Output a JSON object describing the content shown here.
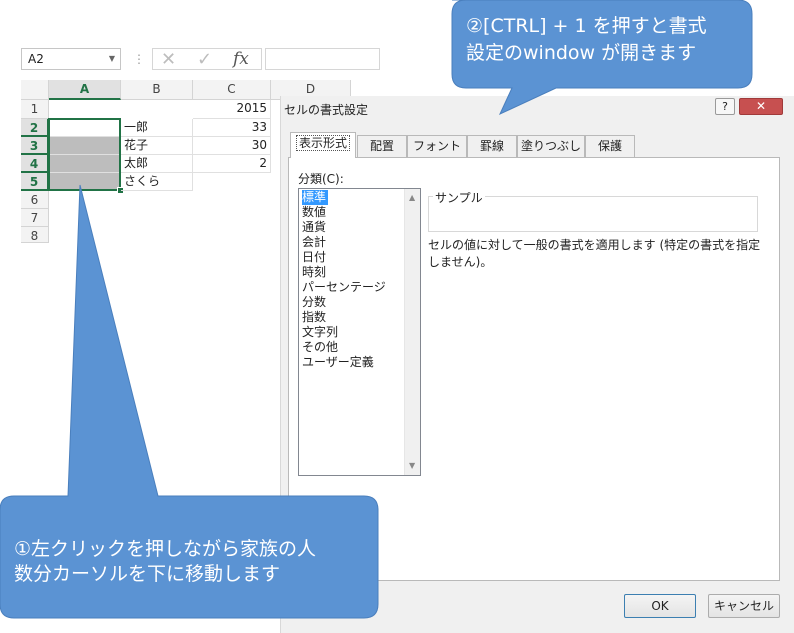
{
  "formula_bar": {
    "name_box": "A2",
    "separator": "⋮",
    "cancel_icon": "✕",
    "enter_icon": "✓",
    "fx_label": "fx"
  },
  "sheet": {
    "columns": [
      "A",
      "B",
      "C",
      "D"
    ],
    "rows": [
      "1",
      "2",
      "3",
      "4",
      "5",
      "6",
      "7",
      "8"
    ],
    "cells": {
      "C1": "2015",
      "B2": "一郎",
      "C2": "33",
      "B3": "花子",
      "C3": "30",
      "B4": "太郎",
      "C4": "2",
      "B5": "さくら"
    }
  },
  "dialog": {
    "title": "セルの書式設定",
    "help_label": "?",
    "close_label": "✕",
    "tabs": [
      "表示形式",
      "配置",
      "フォント",
      "罫線",
      "塗りつぶし",
      "保護"
    ],
    "category_label": "分類(C):",
    "categories": [
      "標準",
      "数値",
      "通貨",
      "会計",
      "日付",
      "時刻",
      "パーセンテージ",
      "分数",
      "指数",
      "文字列",
      "その他",
      "ユーザー定義"
    ],
    "sample_label": "サンプル",
    "description": "セルの値に対して一般の書式を適用します (特定の書式を指定しません)。",
    "ok_label": "OK",
    "cancel_label": "キャンセル"
  },
  "callouts": {
    "top": [
      "②[CTRL] + 1 を押すと書式",
      "設定のwindow が開きます"
    ],
    "bottom": [
      "①左クリックを押しながら家族の人",
      "数分カーソルを下に移動します"
    ],
    "color": "#5b93d3"
  },
  "colors": {
    "excel_green": "#217346",
    "selection_blue": "#3399ff",
    "close_red": "#c75050"
  }
}
